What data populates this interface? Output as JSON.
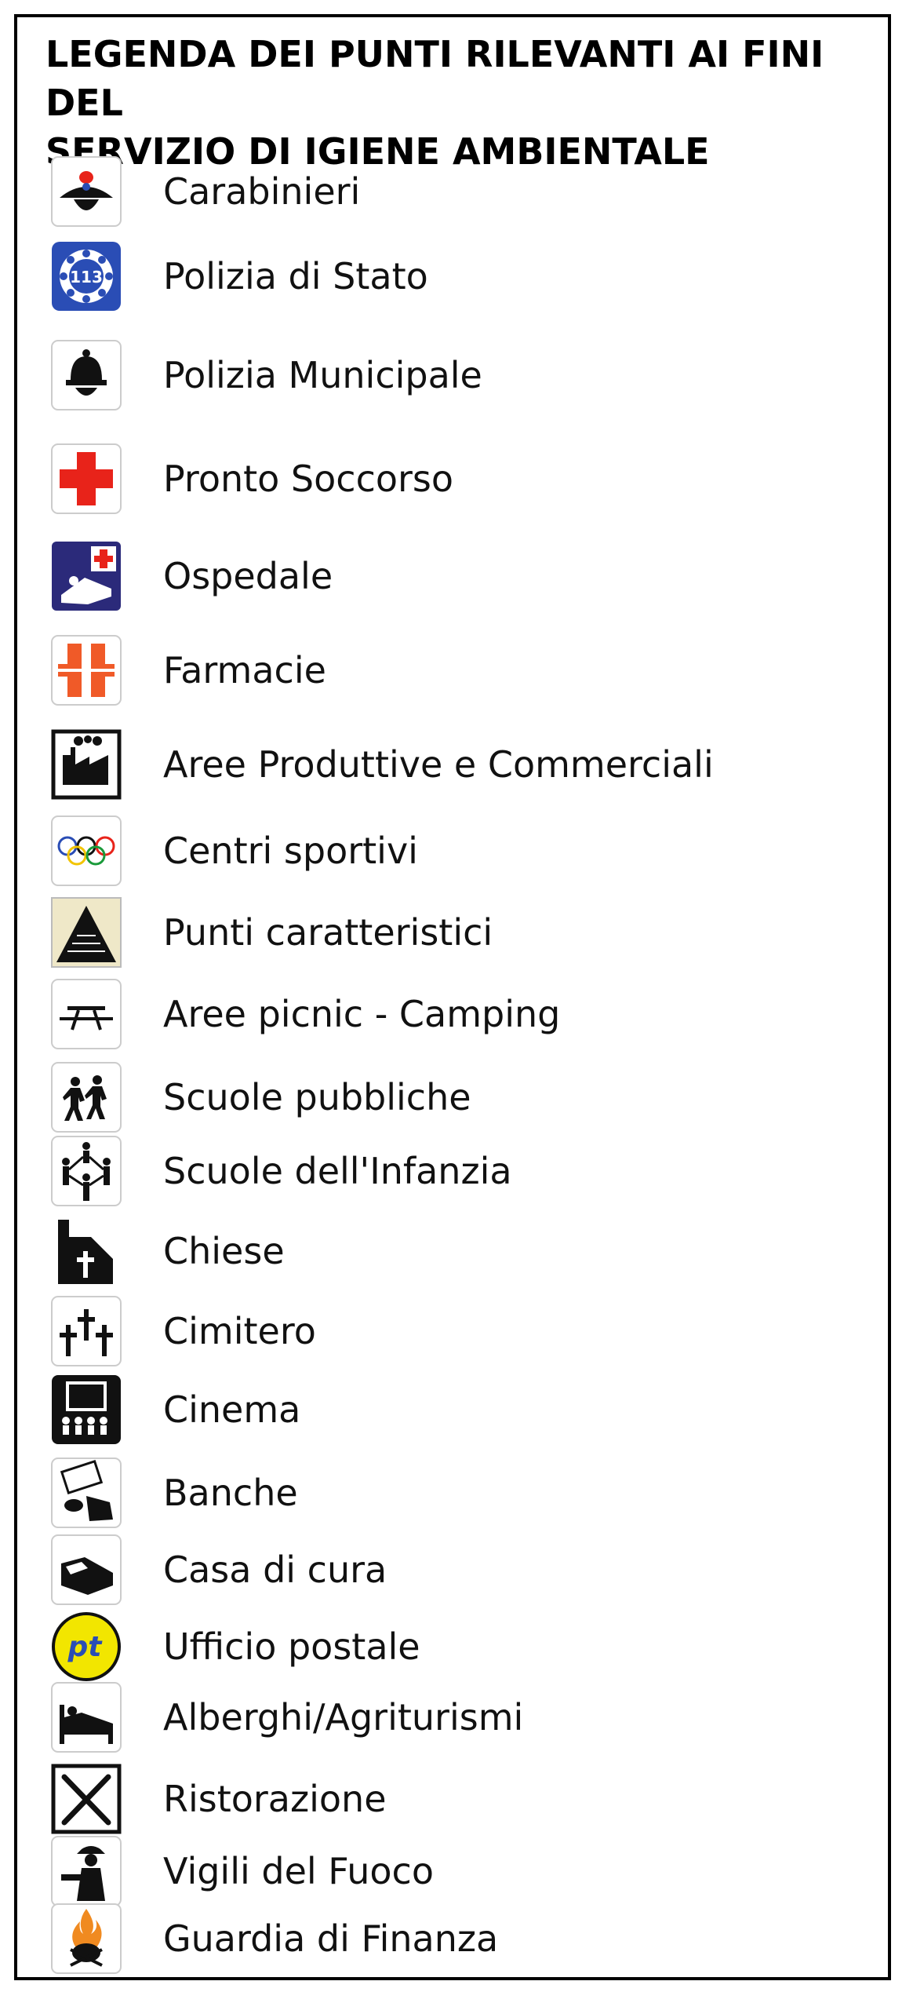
{
  "title": "LEGENDA DEI PUNTI RILEVANTI AI FINI DEL\nSERVIZIO DI IGIENE AMBIENTALE",
  "items": [
    {
      "label": "Carabinieri",
      "icon": "carabinieri-icon"
    },
    {
      "label": "Polizia di Stato",
      "icon": "polizia-di-stato-113-icon"
    },
    {
      "label": "Polizia Municipale",
      "icon": "polizia-municipale-helmet-icon"
    },
    {
      "label": "Pronto Soccorso",
      "icon": "red-cross-icon"
    },
    {
      "label": "Ospedale",
      "icon": "hospital-bed-icon"
    },
    {
      "label": "Farmacie",
      "icon": "pharmacy-cross-icon"
    },
    {
      "label": "Aree Produttive e Commerciali",
      "icon": "factory-icon"
    },
    {
      "label": "Centri sportivi",
      "icon": "olympic-rings-icon"
    },
    {
      "label": "Punti caratteristici",
      "icon": "mountain-icon"
    },
    {
      "label": "Aree picnic - Camping",
      "icon": "picnic-table-icon"
    },
    {
      "label": "Scuole pubbliche",
      "icon": "school-children-icon"
    },
    {
      "label": "Scuole dell'Infanzia",
      "icon": "kindergarten-icon"
    },
    {
      "label": "Chiese",
      "icon": "church-icon"
    },
    {
      "label": "Cimitero",
      "icon": "cemetery-crosses-icon"
    },
    {
      "label": "Cinema",
      "icon": "cinema-icon"
    },
    {
      "label": "Banche",
      "icon": "bank-money-icon"
    },
    {
      "label": "Casa di cura",
      "icon": "nursing-home-bed-icon"
    },
    {
      "label": "Ufficio postale",
      "icon": "post-office-pt-icon"
    },
    {
      "label": "Alberghi/Agriturismi",
      "icon": "hotel-bed-icon"
    },
    {
      "label": "Ristorazione",
      "icon": "fork-knife-icon"
    },
    {
      "label": "Vigili del Fuoco",
      "icon": "firefighter-icon"
    },
    {
      "label": "Guardia di Finanza",
      "icon": "flame-emblem-icon"
    }
  ],
  "colors": {
    "border": "#000000",
    "red": "#e8231a",
    "blue": "#2a4db5",
    "navy": "#2b2a7a",
    "yellow": "#f2e600"
  }
}
